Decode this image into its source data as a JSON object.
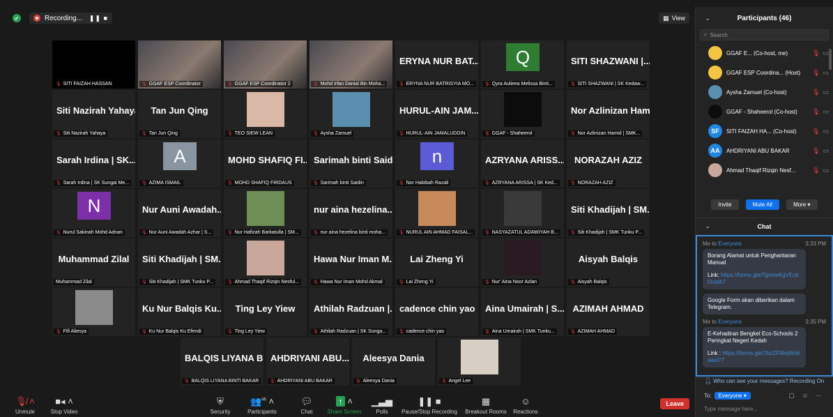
{
  "topbar": {
    "recording_label": "Recording...",
    "rec_controls": "❚❚ ■",
    "view_label": "View"
  },
  "tiles": [
    {
      "big": "",
      "label": "SITI FAIZAH HASSAN",
      "kind": "video-black"
    },
    {
      "big": "",
      "label": "GGAF ESP Coordinator",
      "kind": "video",
      "active": true
    },
    {
      "big": "",
      "label": "GGAF ESP Coordinator 2",
      "kind": "video"
    },
    {
      "big": "",
      "label": "Mohd Irfan Danial Bin Moha...",
      "kind": "video"
    },
    {
      "big": "ERYNA NUR BAT...",
      "label": "ERYNA NUR BATRISYIA MO...",
      "kind": "name"
    },
    {
      "big": "Q",
      "label": "Qyra Aulieea Melissa Binti...",
      "kind": "avatar",
      "color": "#2e7d32"
    },
    {
      "big": "SITI SHAZWANI |...",
      "label": "SITI SHAZWANI | SK Kedaw...",
      "kind": "name"
    },
    {
      "big": "Siti Nazirah Yahaya",
      "label": "Siti Nazirah Yahaya",
      "kind": "name"
    },
    {
      "big": "Tan Jun Qing",
      "label": "Tan Jun Qing",
      "kind": "name"
    },
    {
      "big": "",
      "label": "TEO SIEW LEAN",
      "kind": "photo",
      "color": "#d9b8a8"
    },
    {
      "big": "",
      "label": "Aysha Zamuel",
      "kind": "photo",
      "color": "#5b8fb0"
    },
    {
      "big": "HURUL-AIN JAM...",
      "label": "HURUL-AIN JAMALUDDIN",
      "kind": "name"
    },
    {
      "big": "",
      "label": "GGAF - Shaheerol",
      "kind": "photo",
      "color": "#0c0c0c"
    },
    {
      "big": "Nor Azlinizan Ham...",
      "label": "Nor Azlinizan Hamid | SMK...",
      "kind": "name"
    },
    {
      "big": "Sarah Irdina | SK...",
      "label": "Sarah Irdina | SK Sungai Me...",
      "kind": "name"
    },
    {
      "big": "A",
      "label": "AZIMA ISMAIL",
      "kind": "avatar",
      "color": "#8796a0"
    },
    {
      "big": "MOHD SHAFIQ FI...",
      "label": "MOHD SHAFIQ FIRDAUS",
      "kind": "name"
    },
    {
      "big": "Sarimah binti Saidin",
      "label": "Sarimah binti Saidin",
      "kind": "name"
    },
    {
      "big": "n",
      "label": "Nor Habibah Razali",
      "kind": "avatar",
      "color": "#5b5bd6"
    },
    {
      "big": "AZRYANA ARISS...",
      "label": "AZRYANA ARISSA | SK Ked...",
      "kind": "name"
    },
    {
      "big": "NORAZAH AZIZ",
      "label": "NORAZAH AZIZ",
      "kind": "name"
    },
    {
      "big": "N",
      "label": "Nurul Sakinah Mohd Adnan",
      "kind": "avatar",
      "color": "#7b2fa8"
    },
    {
      "big": "Nur Auni Awadah...",
      "label": "Nur Auni Awadah Azhar | S...",
      "kind": "name"
    },
    {
      "big": "",
      "label": "Nur Hafizah Barkatulla | SM...",
      "kind": "photo",
      "color": "#6d8f55"
    },
    {
      "big": "nur aina hezelina...",
      "label": "nur aina hezelina binti moha...",
      "kind": "name"
    },
    {
      "big": "",
      "label": "NURUL AIN AHMAD FAISAL...",
      "kind": "photo",
      "color": "#c78a5a"
    },
    {
      "big": "",
      "label": "NASYAZATUL ADAWIYAH B...",
      "kind": "photo",
      "color": "#3a3a3a"
    },
    {
      "big": "Siti Khadijah | SM...",
      "label": "Siti Khadijah | SMK Tunku P...",
      "kind": "name"
    },
    {
      "big": "Muhammad Zilal",
      "label": "Muhammad Zilal",
      "kind": "name",
      "nomic": true
    },
    {
      "big": "Siti Khadijah | SM...",
      "label": "Siti Khadijah | SMK Tunku P...",
      "kind": "name"
    },
    {
      "big": "",
      "label": "Ahmad Thaqif Rizqin Nesful...",
      "kind": "photo",
      "color": "#c9a79a"
    },
    {
      "big": "Hawa Nur Iman M...",
      "label": "Hawa Nur Iman Mohd Akmal",
      "kind": "name"
    },
    {
      "big": "Lai Zheng Yi",
      "label": "Lai Zheng Yi",
      "kind": "name"
    },
    {
      "big": "",
      "label": "Nur' Aina Noor Azlan",
      "kind": "photo",
      "color": "#2a1a22"
    },
    {
      "big": "Aisyah Balqis",
      "label": "Aisyah Balqis",
      "kind": "name"
    },
    {
      "big": "",
      "label": "Fifi Aliesya",
      "kind": "photo",
      "color": "#8a8a8a"
    },
    {
      "big": "Ku Nur Balqis Ku...",
      "label": "Ku Nur Balqis Ku Efendi",
      "kind": "name"
    },
    {
      "big": "Ting Ley Yiew",
      "label": "Ting Ley Yiew",
      "kind": "name"
    },
    {
      "big": "Athilah Radzuan |...",
      "label": "Athilah Radzuan | SK Sunga...",
      "kind": "name"
    },
    {
      "big": "cadence chin yao",
      "label": "cadence chin yao",
      "kind": "name"
    },
    {
      "big": "Aina Umairah | S...",
      "label": "Aina Umairah | SMK Tunku...",
      "kind": "name"
    },
    {
      "big": "AZIMAH AHMAD",
      "label": "AZIMAH AHMAD",
      "kind": "name"
    },
    {
      "big": "BALQIS LIYANA B...",
      "label": "BALQIS LIYANA BINTI BAKAR",
      "kind": "name"
    },
    {
      "big": "AHDRIYANI ABU...",
      "label": "AHDRIYANI ABU BAKAR",
      "kind": "name"
    },
    {
      "big": "Aleesya Dania",
      "label": "Aleesya Dania",
      "kind": "name"
    },
    {
      "big": "",
      "label": "Angel Lee",
      "kind": "photo",
      "color": "#d8cfc4"
    }
  ],
  "toolbar": {
    "unmute": "Unmute",
    "stop_video": "Stop Video",
    "security": "Security",
    "participants": "Participants",
    "participants_count": "46",
    "chat": "Chat",
    "share_screen": "Share Screen",
    "polls": "Polls",
    "pause_recording": "Pause/Stop Recording",
    "breakout": "Breakout Rooms",
    "reactions": "Reactions",
    "leave": "Leave"
  },
  "panel": {
    "title": "Participants (46)",
    "search_placeholder": "Search",
    "participants": [
      {
        "name": "GGAF E... (Co-host, me)",
        "initials": "",
        "color": "#f5c542"
      },
      {
        "name": "GGAF ESP Coordina... (Host)",
        "initials": "",
        "color": "#f5c542"
      },
      {
        "name": "Aysha Zamuel (Co-host)",
        "initials": "",
        "color": "#5b8fb0"
      },
      {
        "name": "GGAF - Shaheerol (Co-host)",
        "initials": "",
        "color": "#0c0c0c"
      },
      {
        "name": "SITI FAIZAH HA... (Co-host)",
        "initials": "SF",
        "color": "#1e88e5"
      },
      {
        "name": "AHDRIYANI ABU BAKAR",
        "initials": "AA",
        "color": "#1e88e5"
      },
      {
        "name": "Ahmad Thaqif Rizqin Nesf...",
        "initials": "",
        "color": "#c9a79a"
      }
    ],
    "invite": "Invite",
    "mute_all": "Mute All",
    "more": "More ▾",
    "chat_title": "Chat",
    "messages": [
      {
        "from": "Me to",
        "to": "Everyone",
        "time": "3:33 PM",
        "bubbles": [
          {
            "text": "Borang Alamat untuk Penghantaran Manual",
            "link_prefix": "Link: ",
            "link": "https://forms.gle/TjpmwKgVEcbDrddh7"
          },
          {
            "text": "Google Form akan diberikan dalam Telegram.",
            "link_prefix": "",
            "link": ""
          }
        ]
      },
      {
        "from": "Me to",
        "to": "Everyone",
        "time": "3:35 PM",
        "bubbles": [
          {
            "text": "E-Kehadiran Bengkel Eco-Schools 2 Peringkat Negeri Kedah",
            "link_prefix": "Link : ",
            "link": "https://forms.gle/7bzZFMejWo6aaoi77"
          }
        ]
      }
    ],
    "who_can_see": "Who can see your messages? Recording On",
    "to_label": "To:",
    "to_value": "Everyone ▾",
    "type_placeholder": "Type message here..."
  }
}
